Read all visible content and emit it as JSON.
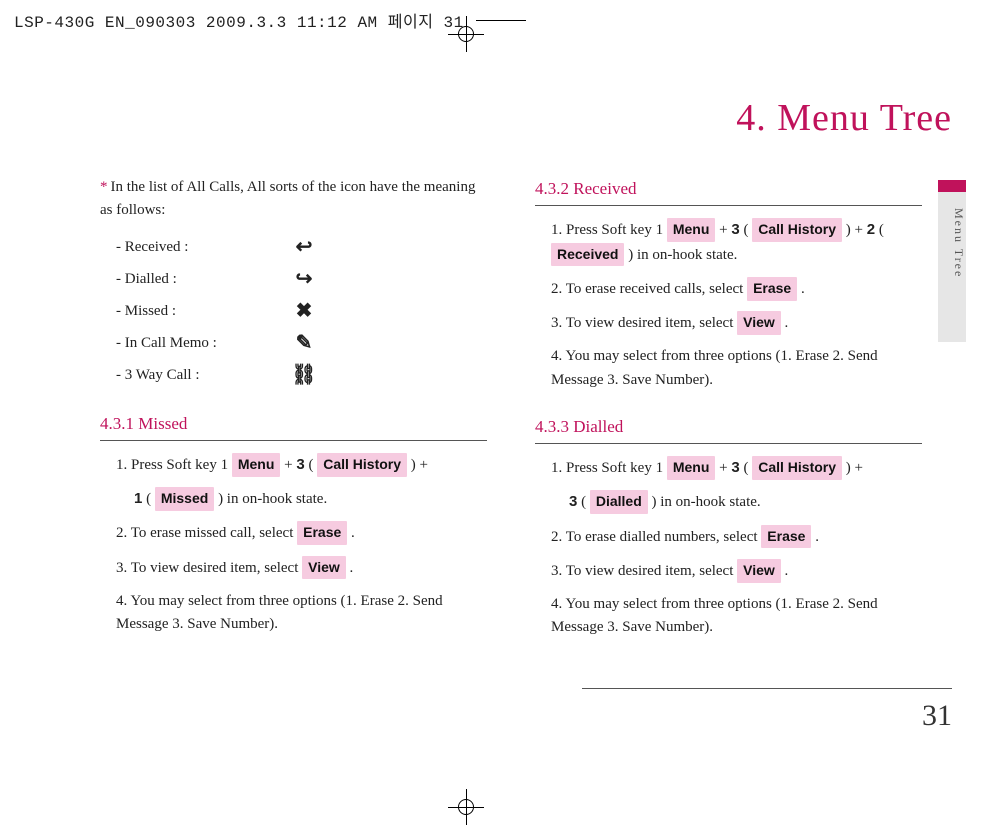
{
  "print_header": "LSP-430G EN_090303  2009.3.3 11:12 AM  페이지 31",
  "chapter_title": "4. Menu Tree",
  "side_tab": "Menu Tree",
  "page_number": "31",
  "left": {
    "intro": "In the list of All Calls, All sorts of the icon have the meaning as follows:",
    "icons": [
      {
        "label": "- Received  :",
        "glyph": "↩"
      },
      {
        "label": "- Dialled :",
        "glyph": "↪"
      },
      {
        "label": "- Missed :",
        "glyph": "✖"
      },
      {
        "label": "- In Call Memo :",
        "glyph": "✎"
      },
      {
        "label": "- 3 Way Call  :",
        "glyph": "⛓"
      }
    ],
    "s431": {
      "head": "4.3.1 Missed",
      "p1a": "1. Press Soft key 1 ",
      "menu": "Menu",
      "plus3": " + ",
      "num3": "3",
      "open": " ( ",
      "call_history": "Call History",
      "close_plus": " ) +",
      "p1b_num": "1",
      "p1b_open": " ( ",
      "missed": "Missed",
      "p1b_rest": " ) in on-hook state.",
      "p2a": "2. To erase missed call, select  ",
      "erase": "Erase",
      "p2b": " .",
      "p3a": "3. To view desired item, select  ",
      "view": "View",
      "p3b": " .",
      "p4": "4. You may select from three options (1. Erase 2. Send Message  3. Save Number)."
    }
  },
  "right": {
    "s432": {
      "head": "4.3.2 Received",
      "p1a": "1. Press Soft key 1 ",
      "menu": "Menu",
      "plus": " + ",
      "num3": "3",
      "open": " ( ",
      "call_history": "Call History",
      "close_plus": " ) +",
      "p1b_num": "2",
      "p1b_open": " ( ",
      "received": "Received",
      "p1b_rest": " ) in on-hook state.",
      "p2a": "2. To erase received calls, select  ",
      "erase": "Erase",
      "p2b": " .",
      "p3a": "3.  To view desired item, select  ",
      "view": "View",
      "p3b": " .",
      "p4": "4. You may select from three options (1. Erase 2. Send Message  3. Save Number)."
    },
    "s433": {
      "head": "4.3.3 Dialled",
      "p1a": "1. Press Soft key 1 ",
      "menu": "Menu",
      "plus": " + ",
      "num3": "3",
      "open": " ( ",
      "call_history": "Call History",
      "close_plus": " ) +",
      "p1b_num": "3",
      "p1b_open": " ( ",
      "dialled": "Dialled",
      "p1b_rest": " ) in on-hook state.",
      "p2a": "2. To erase dialled numbers, select  ",
      "erase": "Erase",
      "p2b": " .",
      "p3a": "3. To view desired item, select  ",
      "view": "View",
      "p3b": " .",
      "p4": "4. You may select from three options (1. Erase 2. Send Message 3. Save Number)."
    }
  }
}
